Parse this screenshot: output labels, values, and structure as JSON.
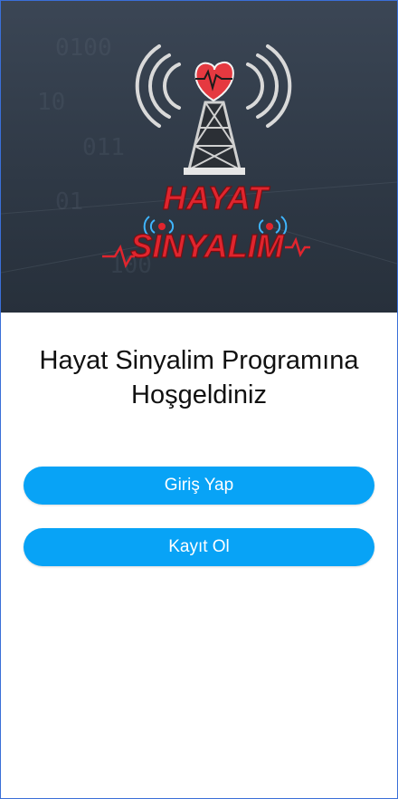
{
  "logo": {
    "line1": "HAYAT",
    "line2": "SINYALIM"
  },
  "welcome": {
    "line1": "Hayat Sinyalim Programına",
    "line2": "Hoşgeldiniz"
  },
  "buttons": {
    "login_label": "Giriş Yap",
    "register_label": "Kayıt Ol"
  },
  "colors": {
    "accent": "#08a3f6",
    "logo_red": "#e0252e"
  }
}
